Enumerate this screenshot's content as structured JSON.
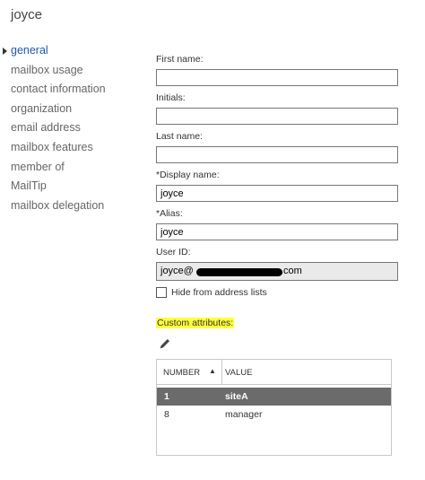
{
  "window": {
    "title": "joyce"
  },
  "nav": {
    "items": [
      {
        "label": "general",
        "active": true
      },
      {
        "label": "mailbox usage"
      },
      {
        "label": "contact information"
      },
      {
        "label": "organization"
      },
      {
        "label": "email address"
      },
      {
        "label": "mailbox features"
      },
      {
        "label": "member of"
      },
      {
        "label": "MailTip"
      },
      {
        "label": "mailbox delegation"
      }
    ]
  },
  "form": {
    "first_name": {
      "label": "First name:",
      "value": ""
    },
    "initials": {
      "label": "Initials:",
      "value": ""
    },
    "last_name": {
      "label": "Last name:",
      "value": ""
    },
    "display_name": {
      "label": "*Display name:",
      "value": "joyce"
    },
    "alias": {
      "label": "*Alias:",
      "value": "joyce"
    },
    "user_id": {
      "label": "User ID:",
      "prefix": "joyce@",
      "suffix": ".com"
    },
    "hide_label": "Hide from address lists"
  },
  "custom": {
    "title": "Custom attributes:",
    "edit_icon": "pencil-icon",
    "columns": {
      "number": "NUMBER",
      "value": "VALUE",
      "sort": "▲"
    },
    "rows": [
      {
        "number": "1",
        "value": "siteA",
        "selected": true
      },
      {
        "number": "8",
        "value": "manager",
        "selected": false
      }
    ]
  },
  "colors": {
    "accent": "#1e5aa8",
    "highlight": "#ffff3c",
    "selected_row": "#6b6b6b"
  }
}
